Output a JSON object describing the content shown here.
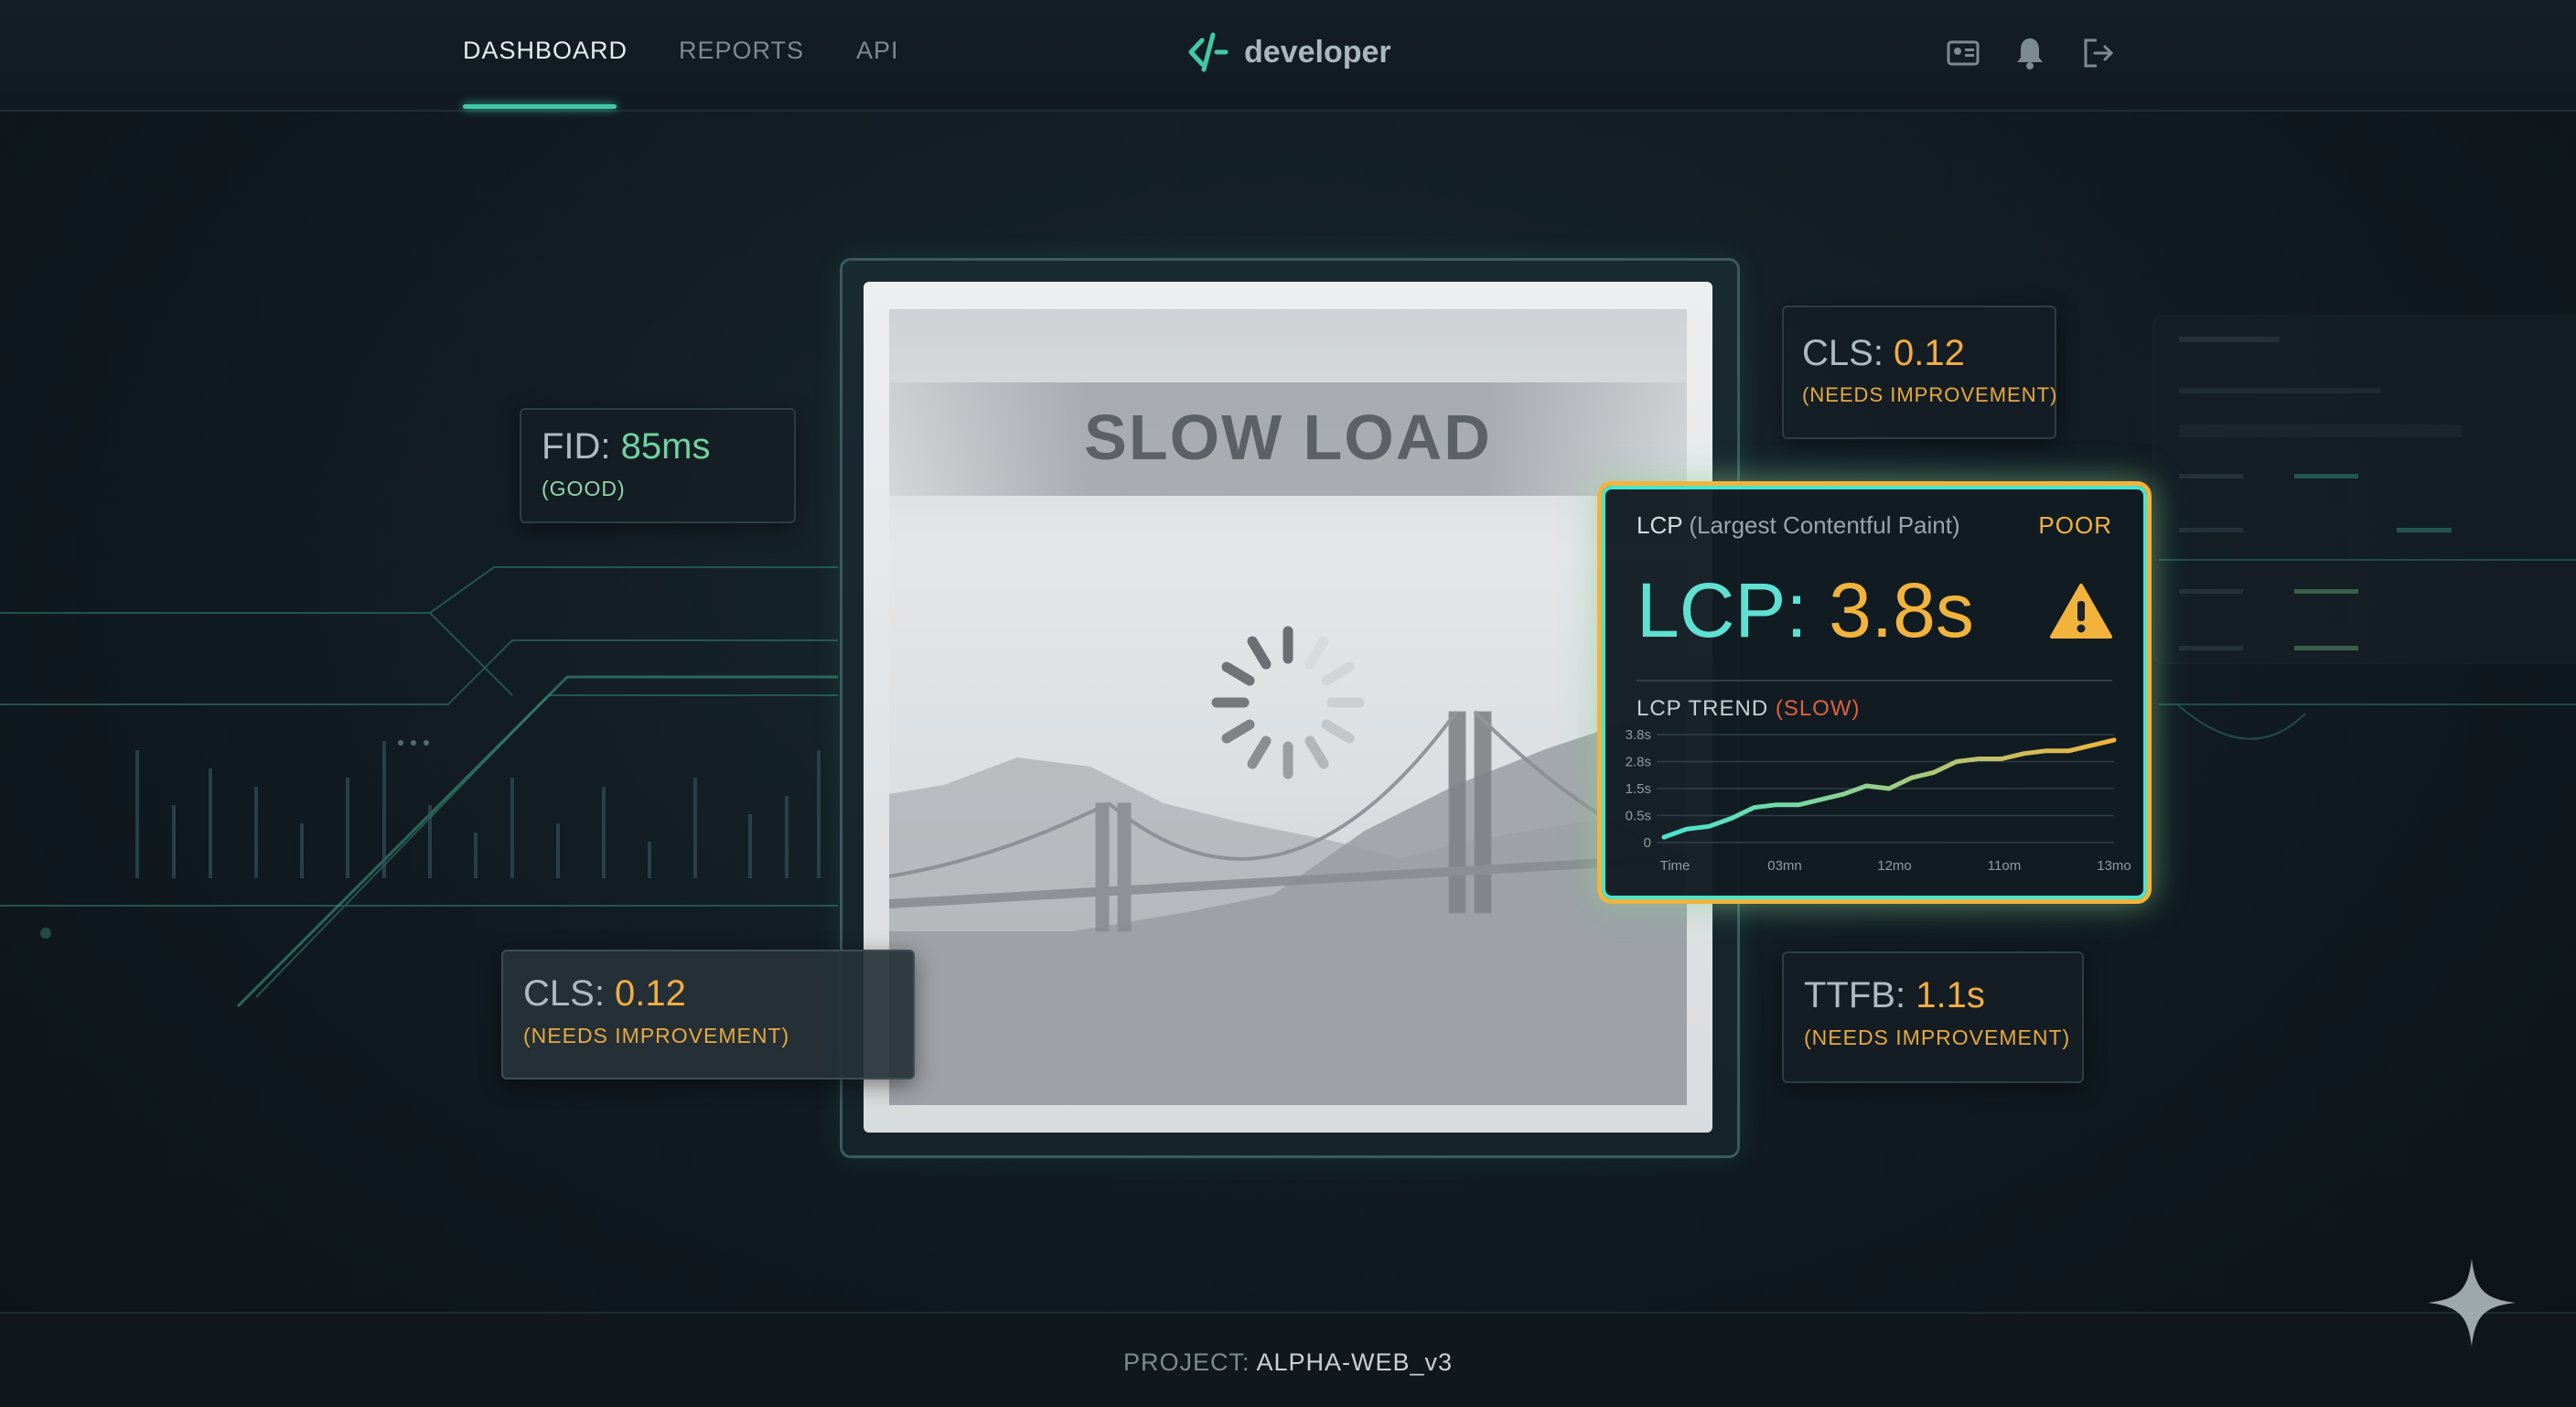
{
  "nav": {
    "tabs": [
      {
        "label": "DASHBOARD",
        "active": true
      },
      {
        "label": "REPORTS",
        "active": false
      },
      {
        "label": "API",
        "active": false
      }
    ],
    "brand": "developer",
    "icons": [
      "id-card-icon",
      "bell-icon",
      "logout-icon"
    ]
  },
  "cards": {
    "fid": {
      "key": "FID: ",
      "value": "85ms",
      "status": "(GOOD)"
    },
    "cls_top": {
      "key": "CLS: ",
      "value": "0.12",
      "status": "(NEEDS IMPROVEMENT)"
    },
    "cls_left": {
      "key": "CLS: ",
      "value": "0.12",
      "status": "(NEEDS IMPROVEMENT)"
    },
    "ttfb": {
      "key": "TTFB: ",
      "value": "1.1s",
      "status": "(NEEDS IMPROVEMENT)"
    }
  },
  "page_preview": {
    "title": "SLOW LOAD"
  },
  "lcp": {
    "abbr": "LCP",
    "full": "(Largest Contentful Paint)",
    "rating": "POOR",
    "key": "LCP: ",
    "value": "3.8s",
    "trend_label": "LCP TREND ",
    "trend_status": "(SLOW)"
  },
  "chart_data": {
    "type": "line",
    "title": "LCP TREND (SLOW)",
    "x_tick_labels": [
      "Time",
      "03mn",
      "12mo",
      "11om",
      "13mo"
    ],
    "y_tick_labels": [
      "3.8s",
      "2.8s",
      "1.5s",
      "0.5s",
      "0"
    ],
    "ylim": [
      0,
      4
    ],
    "grid": true,
    "series": [
      {
        "x": [
          0,
          0.05,
          0.1,
          0.15,
          0.2,
          0.25,
          0.3,
          0.35,
          0.4,
          0.45,
          0.5,
          0.55,
          0.6,
          0.65,
          0.7,
          0.75,
          0.8,
          0.85,
          0.9,
          0.95,
          1.0
        ],
        "values": [
          0.2,
          0.5,
          0.6,
          0.9,
          1.3,
          1.4,
          1.4,
          1.6,
          1.8,
          2.1,
          2.0,
          2.4,
          2.6,
          3.0,
          3.1,
          3.1,
          3.3,
          3.4,
          3.4,
          3.6,
          3.8
        ]
      }
    ],
    "colors": {
      "start": "#46e6d0",
      "end": "#f2b33d"
    }
  },
  "footer": {
    "label": "PROJECT: ",
    "value": "ALPHA-WEB_v3"
  }
}
